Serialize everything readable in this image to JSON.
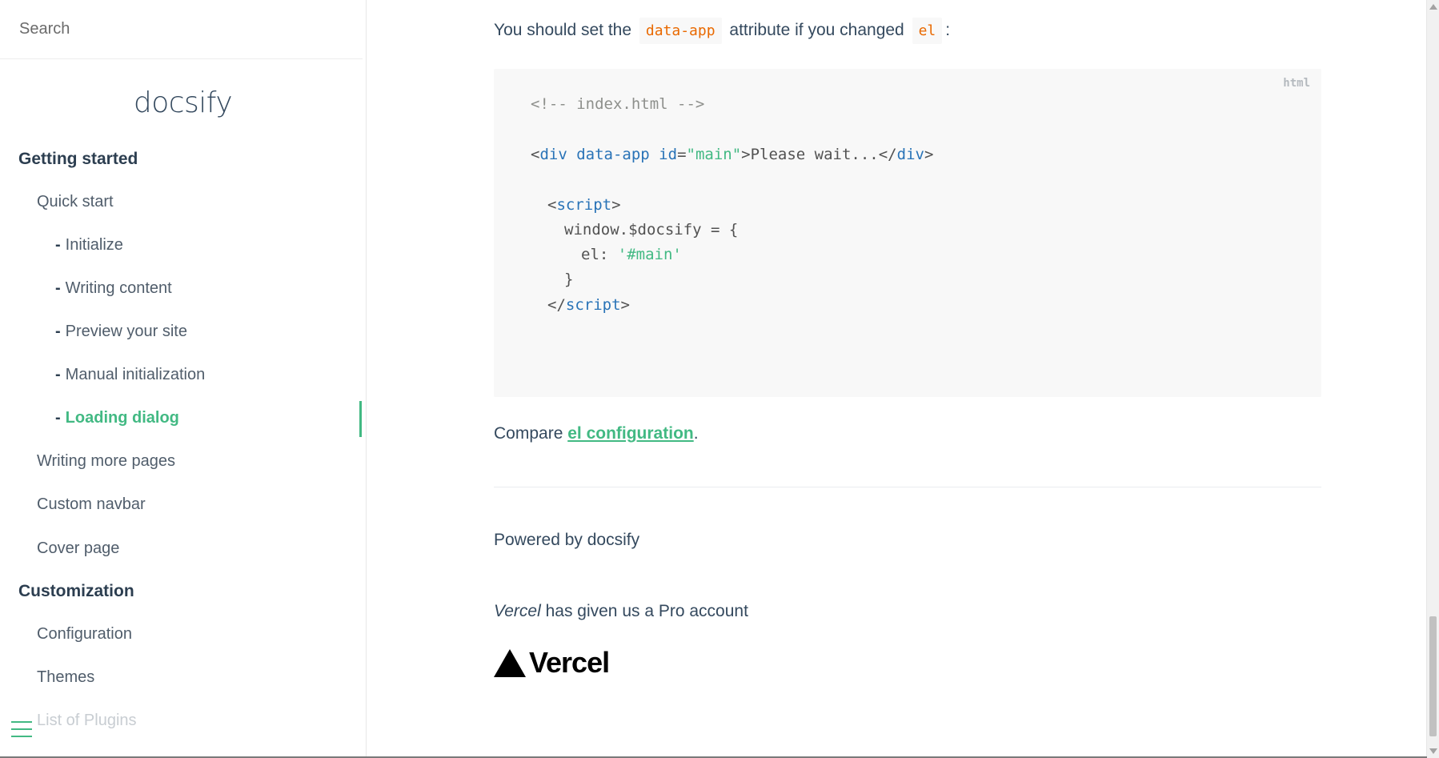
{
  "search": {
    "placeholder": "Search"
  },
  "app_name": "docsify",
  "nav": {
    "sections": [
      {
        "label": "Getting started"
      },
      {
        "label": "Customization"
      }
    ],
    "items": [
      {
        "label": "Quick start"
      },
      {
        "label": "Initialize"
      },
      {
        "label": "Writing content"
      },
      {
        "label": "Preview your site"
      },
      {
        "label": "Manual initialization"
      },
      {
        "label": "Loading dialog"
      },
      {
        "label": "Writing more pages"
      },
      {
        "label": "Custom navbar"
      },
      {
        "label": "Cover page"
      },
      {
        "label": "Configuration"
      },
      {
        "label": "Themes"
      },
      {
        "label": "List of Plugins"
      }
    ],
    "dash": "-",
    "active_color": "#42b983"
  },
  "main": {
    "intro": {
      "before": "You should set the",
      "code1": "data-app",
      "middle": "attribute if you changed",
      "code2": "el",
      "after": ":"
    },
    "code_block": {
      "lang": "html",
      "comment": "<!-- index.html -->",
      "div_open_lt": "<",
      "div_tag": "div",
      "div_attr1": " data-app",
      "div_attr2": " id",
      "eq": "=",
      "div_val": "\"main\"",
      "div_text": ">Please wait...</",
      "div_close_tag": "div",
      "gt": ">",
      "script_open_lt": "<",
      "script_tag": "script",
      "window_line": "window.$docsify = {",
      "el_key": "el: ",
      "el_val": "'#main'",
      "brace": "}",
      "script_close_lt": "</",
      "script_close_tag": "script"
    },
    "compare": {
      "prefix": "Compare",
      "link": "el configuration",
      "suffix": "."
    },
    "powered_by": "Powered by docsify",
    "vercel": {
      "name": "Vercel",
      "rest": " has given us a Pro account",
      "logo_word": "Vercel"
    }
  }
}
